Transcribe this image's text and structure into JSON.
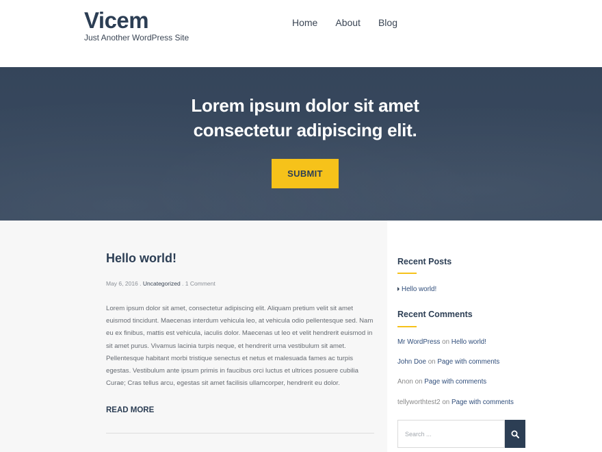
{
  "site": {
    "title": "Vicem",
    "description": "Just Another WordPress Site"
  },
  "nav": {
    "items": [
      {
        "label": "Home"
      },
      {
        "label": "About"
      },
      {
        "label": "Blog"
      }
    ]
  },
  "hero": {
    "line1": "Lorem ipsum dolor sit amet",
    "line2": "consectetur adipiscing elit.",
    "button_label": "SUBMIT"
  },
  "post": {
    "title": "Hello world!",
    "date": "May 6, 2016",
    "separator": " . ",
    "category": "Uncategorized",
    "comments": "1 Comment",
    "excerpt": "Lorem ipsum dolor sit amet, consectetur adipiscing elit. Aliquam pretium velit sit amet euismod tincidunt. Maecenas interdum vehicula leo, at vehicula odio pellentesque sed. Nam eu ex finibus, mattis est vehicula, iaculis dolor. Maecenas ut leo et velit hendrerit euismod in sit amet purus. Vivamus lacinia turpis neque, et hendrerit urna vestibulum sit amet. Pellentesque habitant morbi tristique senectus et netus et malesuada fames ac turpis egestas. Vestibulum ante ipsum primis in faucibus orci luctus et ultrices posuere cubilia Curae; Cras tellus arcu, egestas sit amet facilisis ullamcorper, hendrerit eu dolor.",
    "read_more": "READ MORE"
  },
  "sidebar": {
    "recent_posts_title": "Recent Posts",
    "recent_posts": [
      {
        "label": "Hello world!"
      }
    ],
    "recent_comments_title": "Recent Comments",
    "comments": [
      {
        "author": "Mr WordPress",
        "on": "on",
        "post": "Hello world!"
      },
      {
        "author": "John Doe",
        "on": "on",
        "post": "Page with comments"
      },
      {
        "author": "Anon",
        "on": "on",
        "post": "Page with comments"
      },
      {
        "author": "tellyworthtest2",
        "on": "on",
        "post": "Page with comments"
      }
    ],
    "search_placeholder": "Search ..."
  },
  "colors": {
    "accent": "#f6c21a",
    "navy": "#2c3e54",
    "hero_bg": "#3a4b61"
  }
}
